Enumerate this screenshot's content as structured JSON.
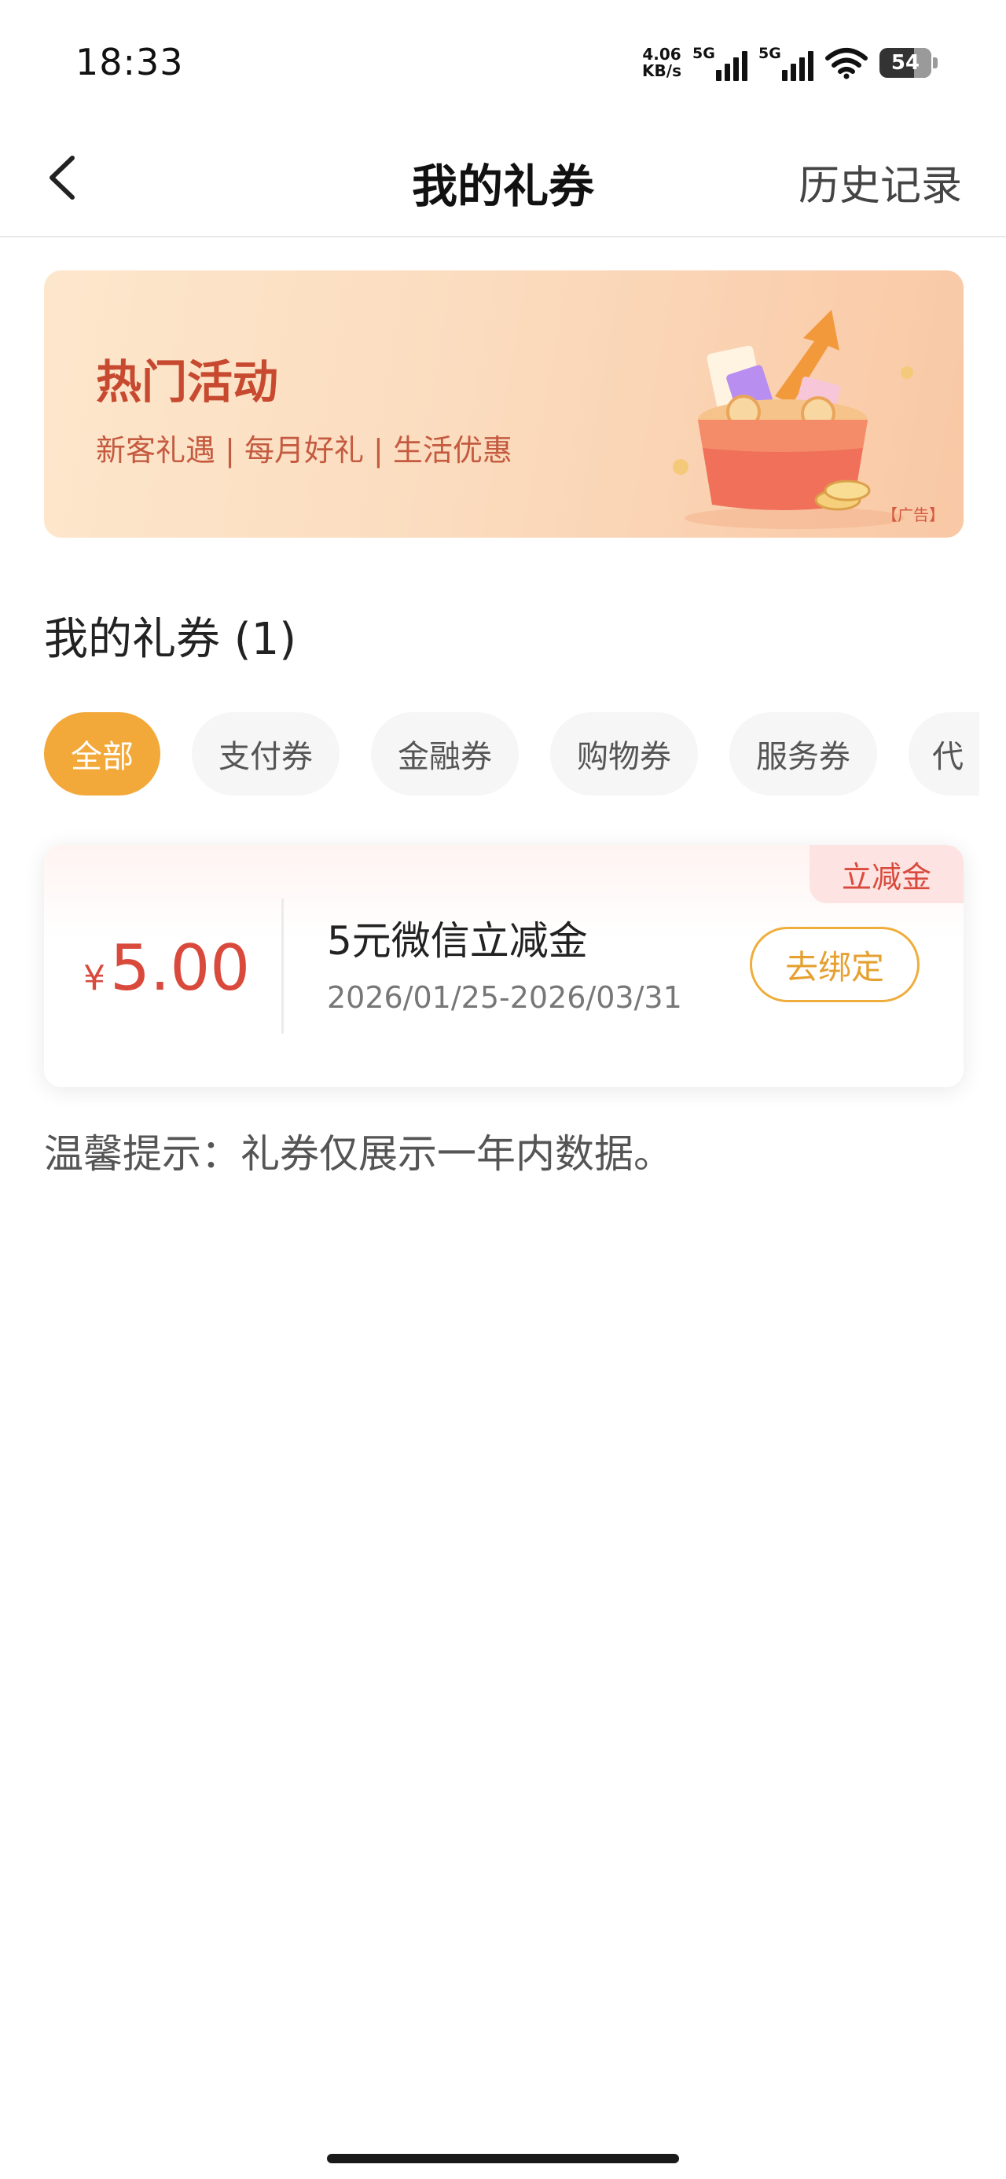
{
  "status_bar": {
    "time": "18:33",
    "net_speed_value": "4.06",
    "net_speed_unit": "KB/s",
    "signal1_label": "5G",
    "signal2_label": "5G",
    "battery": "54"
  },
  "nav": {
    "back_icon": "chevron-left-icon",
    "title": "我的礼券",
    "history_label": "历史记录"
  },
  "banner": {
    "title": "热门活动",
    "subtitle": "新客礼遇 | 每月好礼 | 生活优惠",
    "ad_label": "【广告】"
  },
  "section": {
    "title": "我的礼券 (1)"
  },
  "tabs": [
    {
      "label": "全部",
      "active": true
    },
    {
      "label": "支付券",
      "active": false
    },
    {
      "label": "金融券",
      "active": false
    },
    {
      "label": "购物券",
      "active": false
    },
    {
      "label": "服务券",
      "active": false
    },
    {
      "label": "代",
      "active": false
    }
  ],
  "coupon": {
    "badge": "立减金",
    "currency": "¥",
    "amount": "5.00",
    "name": "5元微信立减金",
    "date_range": "2026/01/25-2026/03/31",
    "action_label": "去绑定"
  },
  "tip": "温馨提示：礼券仅展示一年内数据。",
  "colors": {
    "accent": "#f3a83a",
    "price_red": "#d94a3d",
    "banner_text": "#c74a30"
  }
}
